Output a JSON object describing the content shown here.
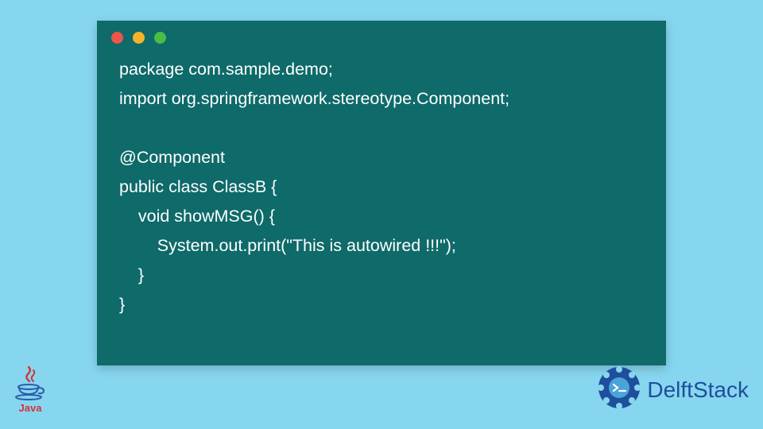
{
  "code_lines": [
    "package com.sample.demo;",
    "import org.springframework.stereotype.Component;",
    "",
    "@Component",
    "public class ClassB {",
    "    void showMSG() {",
    "        System.out.print(\"This is autowired !!!\");",
    "    }",
    "}"
  ],
  "code_joined": "package com.sample.demo;\nimport org.springframework.stereotype.Component;\n\n@Component\npublic class ClassB {\n    void showMSG() {\n        System.out.print(\"This is autowired !!!\");\n    }\n}",
  "window": {
    "dot_colors": {
      "red": "#ec5648",
      "yellow": "#f3b42c",
      "green": "#4bbd47"
    },
    "background": "#0f6a6a"
  },
  "page_background": "#87d6f0",
  "java_logo": {
    "label": "Java"
  },
  "delftstack": {
    "label": "DelftStack"
  }
}
